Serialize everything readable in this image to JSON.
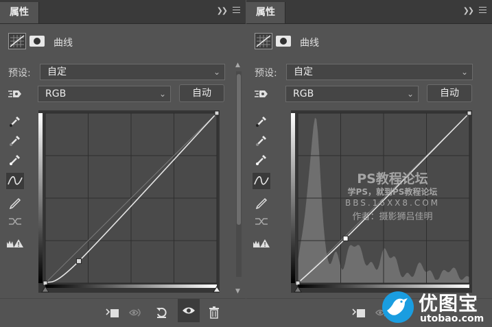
{
  "panels": [
    {
      "tab_label": "属性",
      "header_title": "曲线",
      "preset_label": "预设:",
      "preset_value": "自定",
      "channel_value": "RGB",
      "auto_label": "自动"
    },
    {
      "tab_label": "属性",
      "header_title": "曲线",
      "preset_label": "预设:",
      "preset_value": "自定",
      "channel_value": "RGB",
      "auto_label": "自动"
    }
  ],
  "watermark": {
    "line1": "PS教程论坛",
    "line2": "学PS，就到PS教程论坛",
    "line3": "BBS.16XX8.COM",
    "line4": "作者：摄影狮吕佳明"
  },
  "brand": {
    "name": "优图宝",
    "url": "utobao.com",
    "color": "#1a9de0"
  },
  "icons": {
    "tools": [
      "target-adjust-icon",
      "eyedropper-black-icon",
      "eyedropper-gray-icon",
      "eyedropper-white-icon",
      "curve-points-icon",
      "pencil-icon",
      "smooth-icon",
      "clipping-warning-icon"
    ],
    "footer": [
      "clip-to-layer-icon",
      "view-previous-icon",
      "reset-icon",
      "visibility-eye-icon",
      "trash-icon"
    ]
  },
  "curves": [
    {
      "input_scale": 255,
      "points": [
        [
          0,
          0
        ],
        [
          50,
          33
        ],
        [
          255,
          255
        ]
      ],
      "histogram": false
    },
    {
      "input_scale": 255,
      "points": [
        [
          0,
          0
        ],
        [
          71,
          67
        ],
        [
          255,
          255
        ]
      ],
      "histogram": true
    }
  ]
}
